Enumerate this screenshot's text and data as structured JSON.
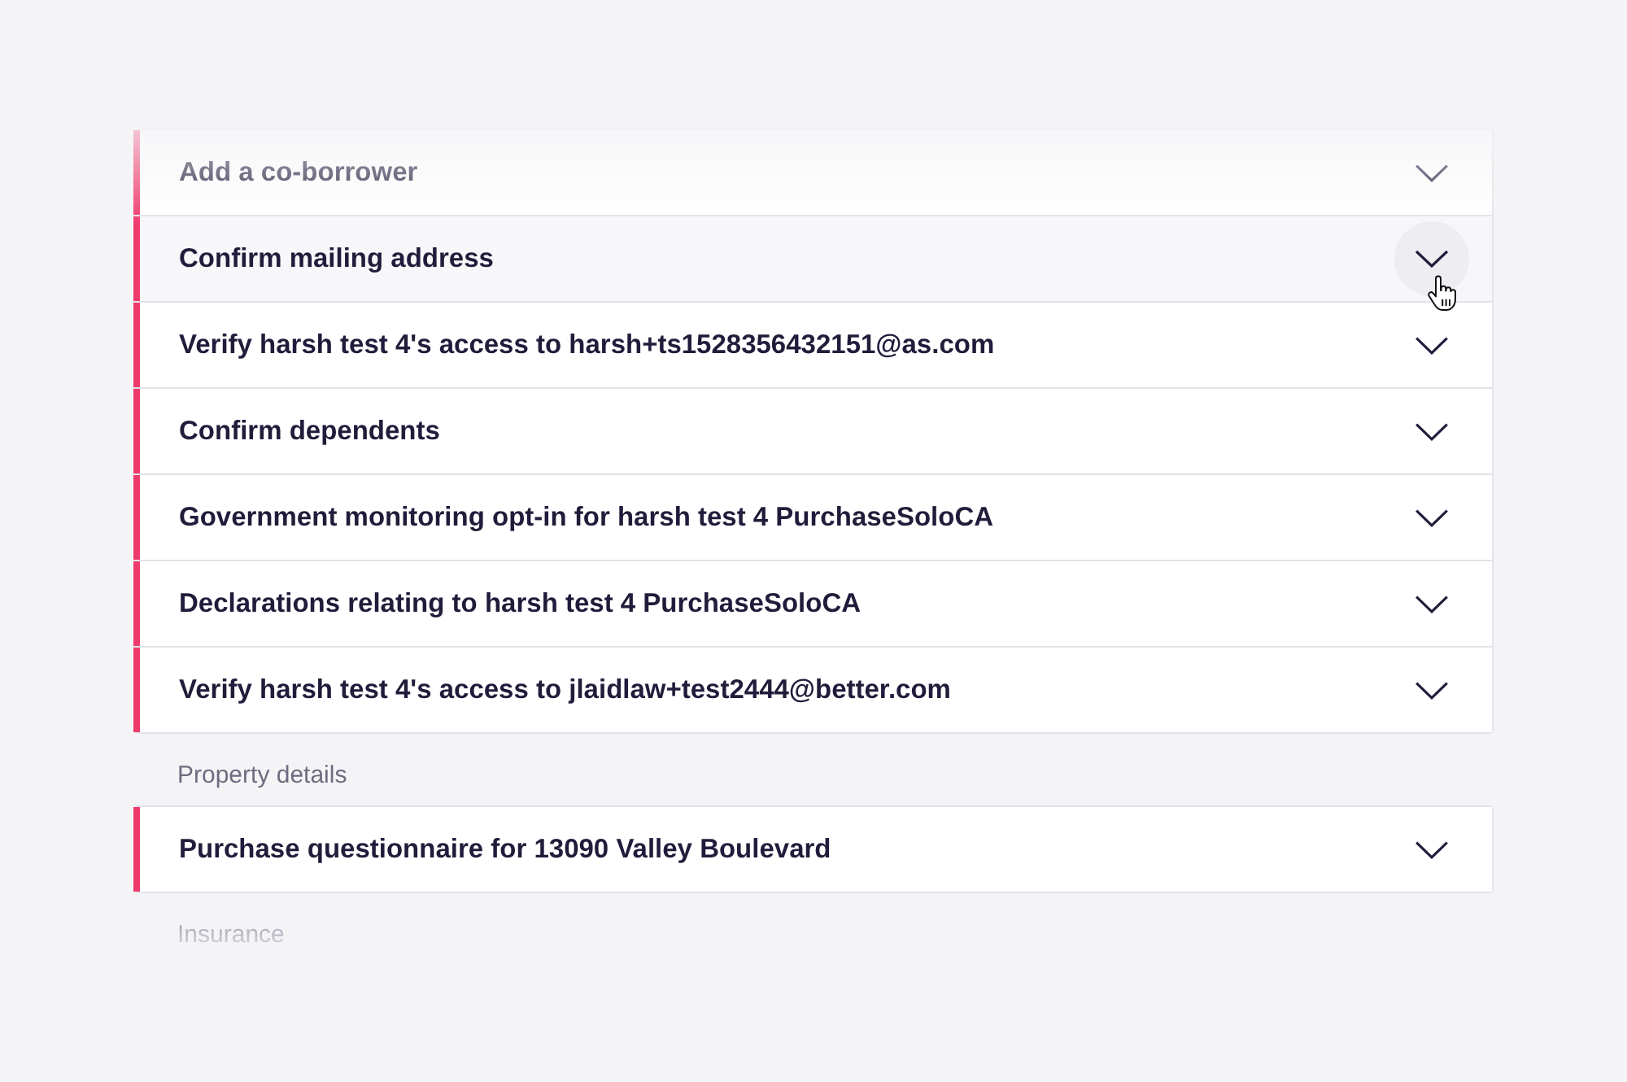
{
  "sections": [
    {
      "rows": [
        {
          "title": "Add a co-borrower",
          "hovered": false
        },
        {
          "title": "Confirm mailing address",
          "hovered": true
        },
        {
          "title": "Verify harsh test 4's access to harsh+ts1528356432151@as.com",
          "hovered": false
        },
        {
          "title": "Confirm dependents",
          "hovered": false
        },
        {
          "title": "Government monitoring opt-in for harsh test 4 PurchaseSoloCA",
          "hovered": false
        },
        {
          "title": "Declarations relating to harsh test 4 PurchaseSoloCA",
          "hovered": false
        },
        {
          "title": "Verify harsh test 4's access to jlaidlaw+test2444@better.com",
          "hovered": false
        }
      ]
    },
    {
      "heading": "Property details",
      "rows": [
        {
          "title": "Purchase questionnaire for 13090 Valley Boulevard",
          "hovered": false
        }
      ]
    },
    {
      "heading": "Insurance"
    }
  ]
}
